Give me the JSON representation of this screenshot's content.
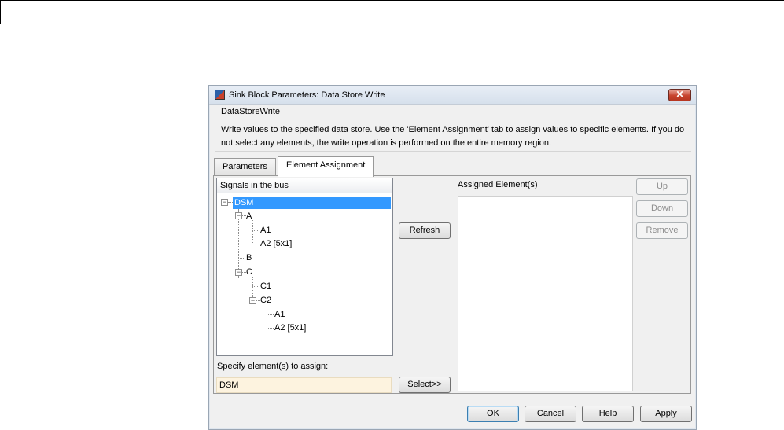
{
  "window": {
    "title": "Sink Block Parameters: Data Store Write",
    "close_glyph": "✕"
  },
  "description": {
    "group_title": "DataStoreWrite",
    "text": "Write values to the specified data store. Use the 'Element Assignment' tab to assign values to specific elements. If you do not select any elements, the write operation is performed on the entire memory region."
  },
  "tabs": [
    {
      "label": "Parameters",
      "active": false
    },
    {
      "label": "Element Assignment",
      "active": true
    }
  ],
  "signals": {
    "header": "Signals in the bus",
    "tree": {
      "dsm": "DSM",
      "a": "A",
      "a1": "A1",
      "a2": "A2 [5x1]",
      "b": "B",
      "c": "C",
      "c1": "C1",
      "c2": "C2",
      "c2_a1": "A1",
      "c2_a2": "A2 [5x1]"
    },
    "selected": "DSM"
  },
  "buttons": {
    "refresh": "Refresh",
    "select": "Select>>",
    "up": "Up",
    "down": "Down",
    "remove": "Remove",
    "ok": "OK",
    "cancel": "Cancel",
    "help": "Help",
    "apply": "Apply"
  },
  "assigned": {
    "label": "Assigned Element(s)",
    "items": []
  },
  "specify": {
    "label": "Specify element(s) to assign:",
    "value": "DSM"
  },
  "icons": {
    "app": "simulink-block-icon",
    "close": "close-icon",
    "collapse": "tree-collapse-icon"
  }
}
